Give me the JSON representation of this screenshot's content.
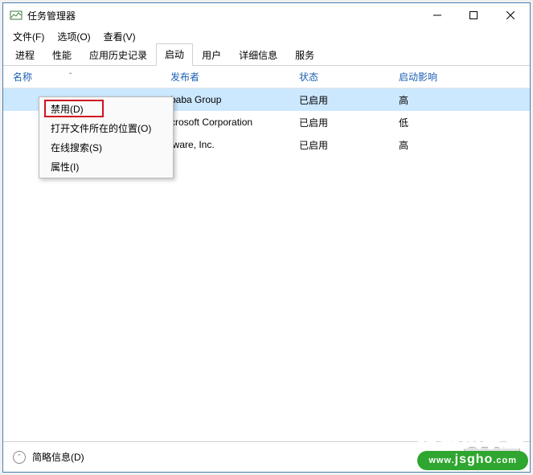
{
  "titlebar": {
    "title": "任务管理器"
  },
  "menubar": [
    {
      "label": "文件(F)"
    },
    {
      "label": "选项(O)"
    },
    {
      "label": "查看(V)"
    }
  ],
  "tabs": [
    {
      "label": "进程"
    },
    {
      "label": "性能"
    },
    {
      "label": "应用历史记录"
    },
    {
      "label": "启动"
    },
    {
      "label": "用户"
    },
    {
      "label": "详细信息"
    },
    {
      "label": "服务"
    }
  ],
  "headers": {
    "name": "名称",
    "publisher": "发布者",
    "status": "状态",
    "impact": "启动影响"
  },
  "rows": [
    {
      "publisher": "baba Group",
      "status": "已启用",
      "impact": "高"
    },
    {
      "publisher": "crosoft Corporation",
      "status": "已启用",
      "impact": "低"
    },
    {
      "publisher": "lware, Inc.",
      "status": "已启用",
      "impact": "高"
    }
  ],
  "context_menu": [
    {
      "label": "禁用(D)"
    },
    {
      "label": "打开文件所在的位置(O)"
    },
    {
      "label": "在线搜索(S)"
    },
    {
      "label": "属性(I)"
    }
  ],
  "footer": {
    "brief": "简略信息(D)",
    "disable_btn": "禁用(A)"
  },
  "watermark": {
    "top": "技术员联盟",
    "bottom_prefix": "www.",
    "bottom_domain": "jsgho",
    "bottom_suffix": ".com"
  }
}
